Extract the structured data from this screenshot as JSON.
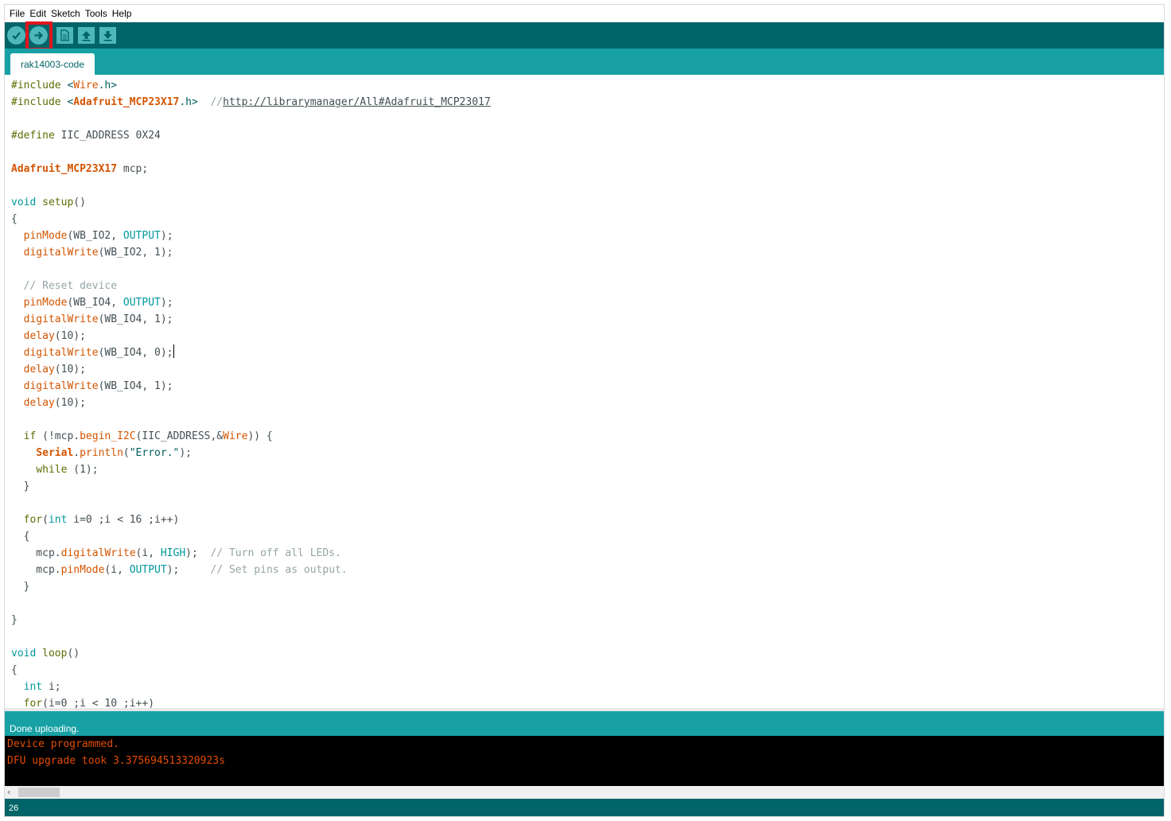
{
  "menu": {
    "items": [
      {
        "label": "File"
      },
      {
        "label": "Edit"
      },
      {
        "label": "Sketch"
      },
      {
        "label": "Tools"
      },
      {
        "label": "Help"
      }
    ]
  },
  "toolbar": {
    "buttons": [
      {
        "icon": "verify-icon"
      },
      {
        "icon": "upload-icon",
        "highlighted": true
      },
      {
        "icon": "new-icon"
      },
      {
        "icon": "open-icon"
      },
      {
        "icon": "save-icon"
      }
    ]
  },
  "tab": {
    "label": "rak14003-code"
  },
  "editor": {
    "lines": [
      "#include <Wire.h>",
      "#include <Adafruit_MCP23X17.h>  //http://librarymanager/All#Adafruit_MCP23017",
      "",
      "#define IIC_ADDRESS 0X24",
      "",
      "Adafruit_MCP23X17 mcp;",
      "",
      "void setup()",
      "{",
      "  pinMode(WB_IO2, OUTPUT);",
      "  digitalWrite(WB_IO2, 1);",
      "",
      "  // Reset device",
      "  pinMode(WB_IO4, OUTPUT);",
      "  digitalWrite(WB_IO4, 1);",
      "  delay(10);",
      "  digitalWrite(WB_IO4, 0);",
      "  delay(10);",
      "  digitalWrite(WB_IO4, 1);",
      "  delay(10);",
      "",
      "  if (!mcp.begin_I2C(IIC_ADDRESS,&Wire)) {",
      "    Serial.println(\"Error.\");",
      "    while (1);",
      "  }",
      "",
      "  for(int i=0 ;i < 16 ;i++)",
      "  {",
      "    mcp.digitalWrite(i, HIGH);  // Turn off all LEDs.",
      "    mcp.pinMode(i, OUTPUT);     // Set pins as output.",
      "  }",
      "",
      "}",
      "",
      "void loop()",
      "{",
      "  int i;",
      "  for(i=0 ;i < 10 ;i++)"
    ],
    "cursor_line": 17
  },
  "status": {
    "message": "Done uploading."
  },
  "console": {
    "lines": [
      "Device programmed.",
      "DFU upgrade took 3.375694513320923s"
    ]
  },
  "footer": {
    "line_number": "26"
  },
  "colors": {
    "toolbar_bg": "#006468",
    "tab_bar_bg": "#17a1a5",
    "console_text": "#e34c00",
    "highlight": "#e0161e"
  }
}
